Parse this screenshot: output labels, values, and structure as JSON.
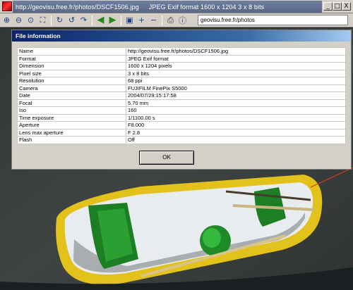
{
  "window": {
    "title_url": "http://geovisu.free.fr/photos/DSCF1506.jpg",
    "title_format": "JPEG Exif format 1600 x 1204  3 x 8 bits",
    "buttons": [
      "_",
      "□",
      "X"
    ]
  },
  "toolbar": {
    "url_value": "geovisu.free.fr/photos"
  },
  "dialog": {
    "title": "File information",
    "rows": [
      {
        "key": "Name",
        "value": "http://geovisu.free.fr/photos/DSCF1506.jpg"
      },
      {
        "key": "Format",
        "value": "JPEG Exif format"
      },
      {
        "key": "Dimension",
        "value": "1600 x 1204 pixels"
      },
      {
        "key": "Pixel size",
        "value": "3 x 8 bits"
      },
      {
        "key": "Resolution",
        "value": "68 ppi"
      },
      {
        "key": "Camera",
        "value": "FUJIFILM FinePix S5000"
      },
      {
        "key": "Date",
        "value": "2004/07/29:15:17:58"
      },
      {
        "key": "Focal",
        "value": "5.70 mm"
      },
      {
        "key": "Iso",
        "value": "160"
      },
      {
        "key": "Time exposure",
        "value": "1/1100.00 s"
      },
      {
        "key": "Aperture",
        "value": "F8.000"
      },
      {
        "key": "Lens max aperture",
        "value": "F 2.8"
      },
      {
        "key": "Flash",
        "value": "Off"
      }
    ],
    "ok_label": "OK"
  }
}
